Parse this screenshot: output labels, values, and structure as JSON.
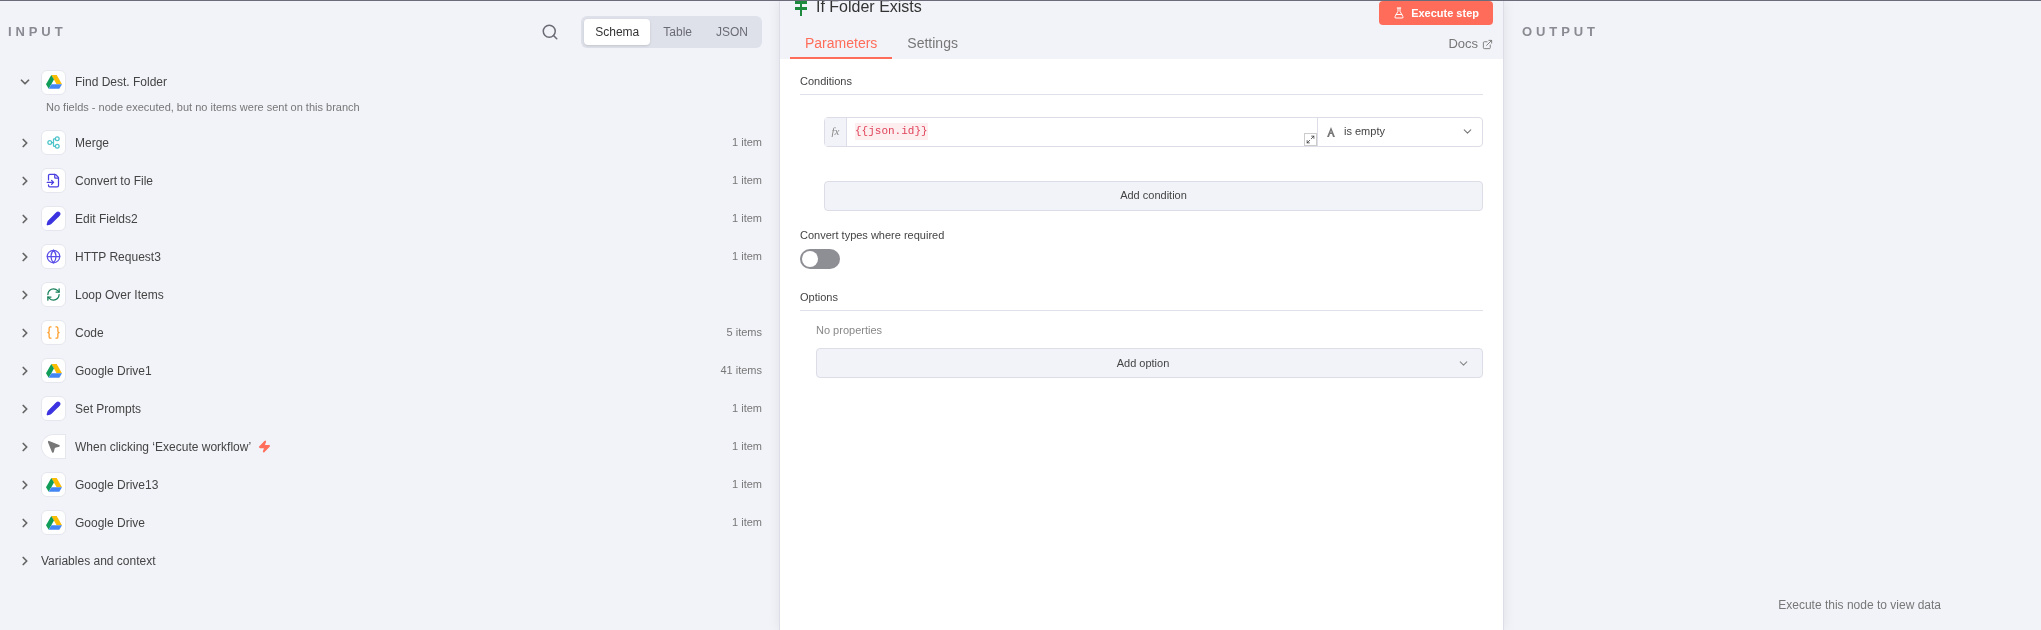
{
  "input_panel": {
    "title": "INPUT",
    "view_tabs": [
      {
        "label": "Schema",
        "selected": true
      },
      {
        "label": "Table",
        "selected": false
      },
      {
        "label": "JSON",
        "selected": false
      }
    ],
    "nodes": [
      {
        "kind": "drive",
        "name": "Find Dest. Folder",
        "expanded": true,
        "note": "No fields - node executed, but no items were sent on this branch"
      },
      {
        "kind": "merge",
        "name": "Merge",
        "expanded": false,
        "count": "1 item"
      },
      {
        "kind": "convert",
        "name": "Convert to File",
        "expanded": false,
        "count": "1 item"
      },
      {
        "kind": "edit",
        "name": "Edit Fields2",
        "expanded": false,
        "count": "1 item"
      },
      {
        "kind": "http",
        "name": "HTTP Request3",
        "expanded": false,
        "count": "1 item"
      },
      {
        "kind": "loop",
        "name": "Loop Over Items",
        "expanded": false
      },
      {
        "kind": "code",
        "name": "Code",
        "expanded": false,
        "count": "5 items"
      },
      {
        "kind": "drive",
        "name": "Google Drive1",
        "expanded": false,
        "count": "41 items"
      },
      {
        "kind": "edit",
        "name": "Set Prompts",
        "expanded": false,
        "count": "1 item"
      },
      {
        "kind": "manual",
        "name": "When clicking ‘Execute workflow’",
        "expanded": false,
        "count": "1 item"
      },
      {
        "kind": "drive",
        "name": "Google Drive13",
        "expanded": false,
        "count": "1 item"
      },
      {
        "kind": "drive",
        "name": "Google Drive",
        "expanded": false,
        "count": "1 item"
      }
    ],
    "variables": {
      "label": "Variables and context",
      "expanded": false
    }
  },
  "node_panel": {
    "title": "If Folder Exists",
    "execute_button": "Execute step",
    "tabs": [
      {
        "label": "Parameters",
        "selected": true
      },
      {
        "label": "Settings",
        "selected": false
      }
    ],
    "docs_link": "Docs",
    "conditions_label": "Conditions",
    "condition": {
      "prefix": "fx",
      "value": "{{json.id}}",
      "operator": "is empty"
    },
    "add_condition": "Add condition",
    "convert_types": {
      "label": "Convert types where required",
      "on": false
    },
    "options_label": "Options",
    "no_properties": "No properties",
    "add_option": "Add option"
  },
  "output_panel": {
    "title": "OUTPUT",
    "hint": "Execute this node to view data"
  }
}
